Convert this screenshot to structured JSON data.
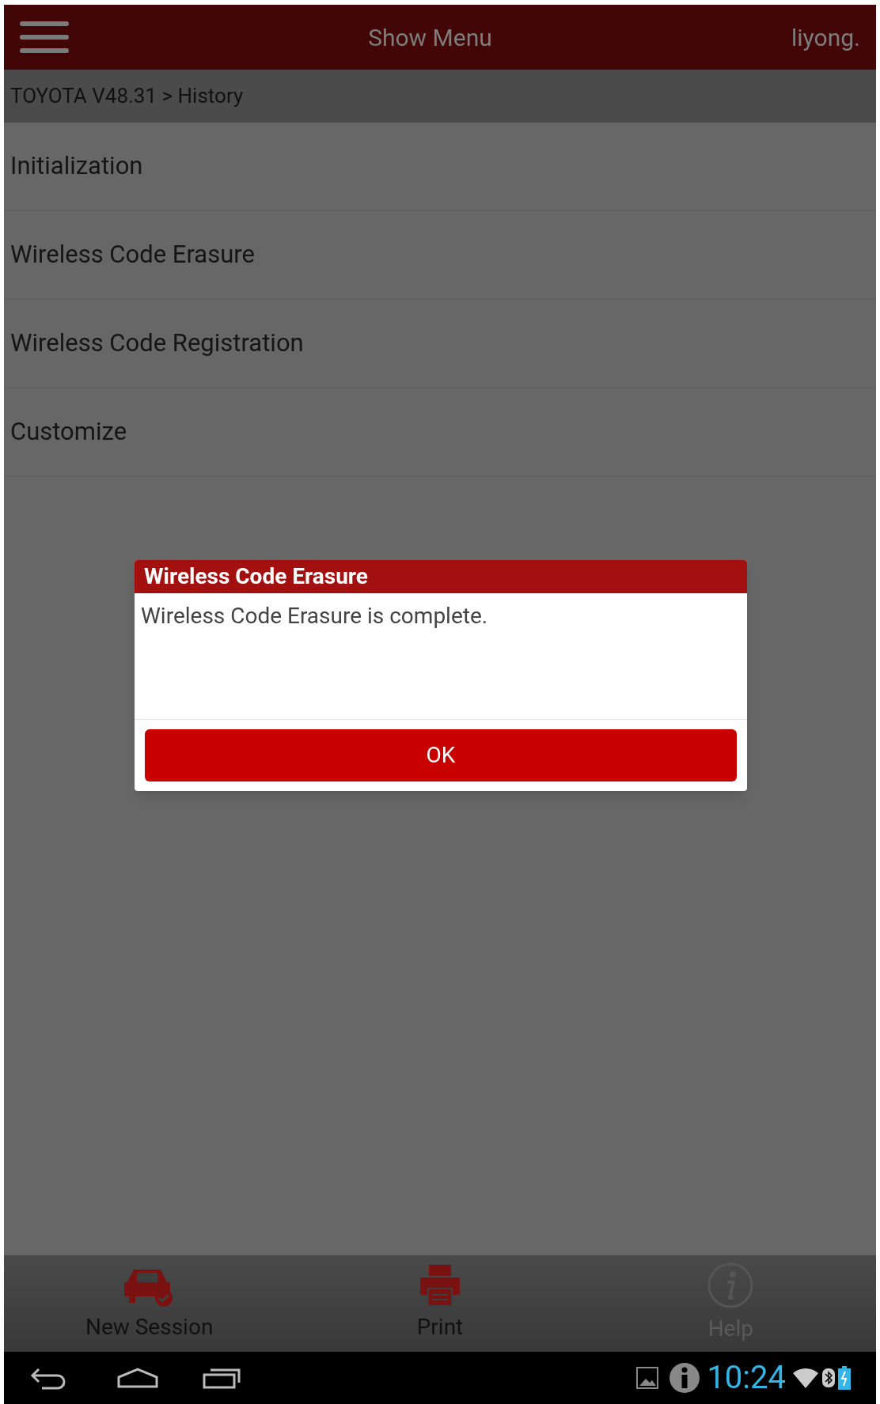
{
  "top_bar": {
    "title": "Show Menu",
    "user": "liyong."
  },
  "breadcrumb": "TOYOTA V48.31 > History",
  "menu_items": [
    "Initialization",
    "Wireless Code Erasure",
    "Wireless Code Registration",
    "Customize"
  ],
  "dialog": {
    "title": "Wireless Code Erasure",
    "message": "Wireless Code Erasure is complete.",
    "button": "OK"
  },
  "bottom_actions": [
    {
      "kind": "car",
      "label": "New Session",
      "disabled": false
    },
    {
      "kind": "print",
      "label": "Print",
      "disabled": false
    },
    {
      "kind": "help",
      "label": "Help",
      "disabled": true
    }
  ],
  "status_bar": {
    "time": "10:24"
  }
}
